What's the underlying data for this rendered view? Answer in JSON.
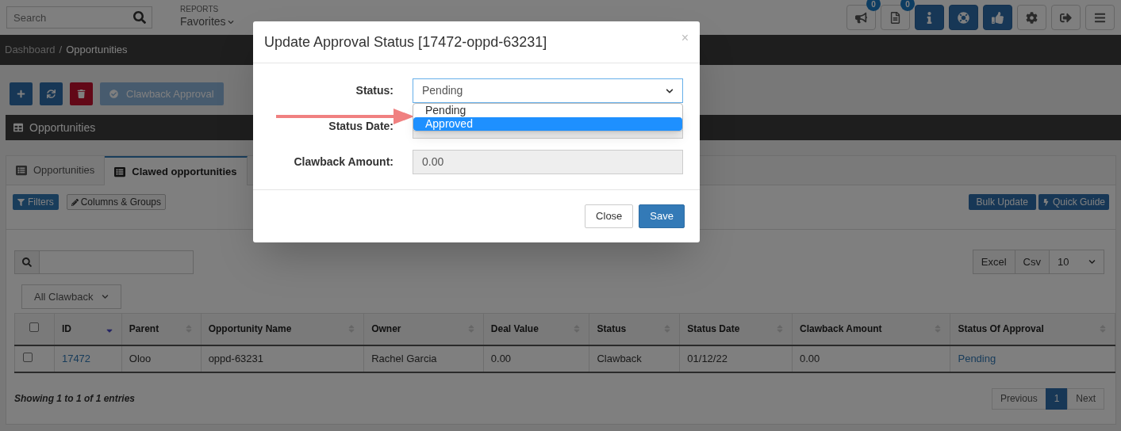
{
  "topbar": {
    "search": {
      "placeholder": "Search"
    },
    "reports_label": "REPORTS",
    "favorites": "Favorites",
    "icons": [
      {
        "kind": "megaphone",
        "badge": "0"
      },
      {
        "kind": "document",
        "badge": "0"
      },
      {
        "kind": "info"
      },
      {
        "kind": "lifebuoy"
      },
      {
        "kind": "thumbs-up"
      },
      {
        "kind": "settings"
      },
      {
        "kind": "logout"
      },
      {
        "kind": "menu"
      }
    ]
  },
  "breadcrumb": {
    "items": [
      "Dashboard",
      "Opportunities"
    ],
    "separator": "/"
  },
  "actions": [
    {
      "kind": "add"
    },
    {
      "kind": "refresh"
    },
    {
      "kind": "delete"
    },
    {
      "kind": "approve",
      "label": "Clawback Approval"
    }
  ],
  "panel": {
    "title": "Opportunities",
    "tabs": [
      {
        "label": "Opportunities",
        "selected": false
      },
      {
        "label": "Clawed opportunities",
        "selected": true
      }
    ],
    "toolbar": {
      "filters": "Filters",
      "columns": "Columns & Groups",
      "bulk_update": "Bulk Update",
      "quick_guide": "Quick Guide"
    },
    "export_buttons": [
      "Excel",
      "Csv"
    ],
    "page_size": "10",
    "filter_select": "All Clawback",
    "table": {
      "header_checked": false,
      "columns": [
        {
          "label": "ID",
          "sorted": true,
          "kind": "link"
        },
        {
          "label": "Parent",
          "sorted": false,
          "kind": "text"
        },
        {
          "label": "Opportunity Name",
          "sorted": false,
          "kind": "text"
        },
        {
          "label": "Owner",
          "sorted": false,
          "kind": "text"
        },
        {
          "label": "Deal Value",
          "sorted": false,
          "kind": "text"
        },
        {
          "label": "Status",
          "sorted": false,
          "kind": "text"
        },
        {
          "label": "Status Date",
          "sorted": false,
          "kind": "text"
        },
        {
          "label": "Clawback Amount",
          "sorted": false,
          "kind": "text"
        },
        {
          "label": "Status Of Approval",
          "sorted": false,
          "kind": "link"
        }
      ],
      "rows": [
        {
          "checked": false,
          "cells": [
            "17472",
            "Oloo",
            "oppd-63231",
            "Rachel Garcia",
            "0.00",
            "Clawback",
            "01/12/22",
            "0.00",
            "Pending"
          ]
        }
      ]
    },
    "info": "Showing 1 to 1 of 1 entries",
    "pagination": [
      {
        "label": "Previous",
        "selected": false
      },
      {
        "label": "1",
        "selected": true
      },
      {
        "label": "Next",
        "selected": false
      }
    ]
  },
  "modal": {
    "title": "Update Approval Status [17472-oppd-63231]",
    "close": "×",
    "fields": [
      {
        "kind": "select",
        "label": "Status:",
        "value": "Pending",
        "expanded": true,
        "options": [
          {
            "label": "Pending",
            "highlighted": false
          },
          {
            "label": "Approved",
            "highlighted": true
          }
        ]
      },
      {
        "kind": "date",
        "label": "Status Date:"
      },
      {
        "kind": "text",
        "label": "Clawback Amount:",
        "value": "0.00"
      }
    ],
    "buttons": [
      {
        "kind": "default",
        "label": "Close"
      },
      {
        "kind": "primary",
        "label": "Save"
      }
    ]
  }
}
